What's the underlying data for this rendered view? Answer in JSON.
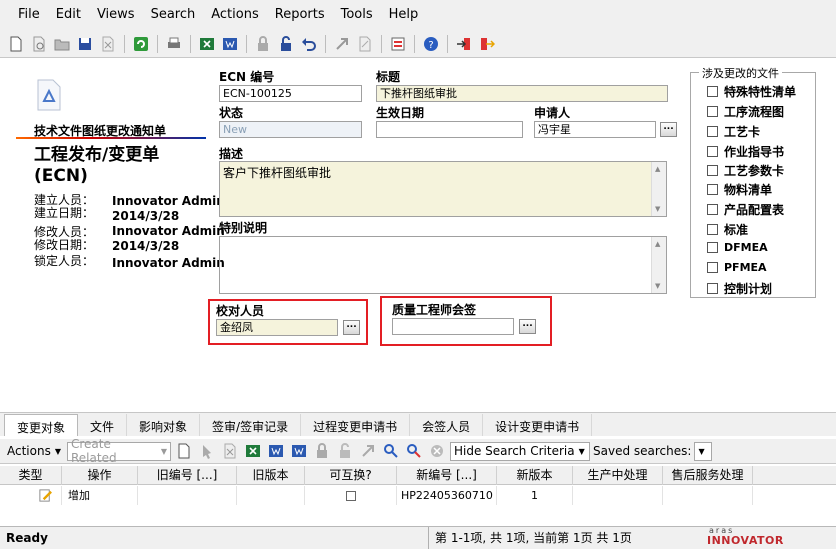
{
  "menu": [
    "File",
    "Edit",
    "Views",
    "Search",
    "Actions",
    "Reports",
    "Tools",
    "Help"
  ],
  "form": {
    "title_small": "技术文件图纸更改通知单",
    "title_big_line1": "工程发布/变更单",
    "title_big_line2": "(ECN)",
    "info": [
      {
        "label": "建立人员：",
        "value": "Innovator Admin"
      },
      {
        "label": "建立日期：",
        "value": "2014/3/28"
      },
      {
        "label": "修改人员：",
        "value": "Innovator Admin"
      },
      {
        "label": "修改日期：",
        "value": "2014/3/28"
      },
      {
        "label": "锁定人员：",
        "value": "Innovator Admin"
      }
    ],
    "ecn_no_label": "ECN 编号",
    "ecn_no_value": "ECN-100125",
    "title_label": "标题",
    "title_value": "下推杆图纸审批",
    "state_label": "状态",
    "state_value": "New",
    "effective_label": "生效日期",
    "effective_value": "",
    "applicant_label": "申请人",
    "applicant_value": "冯宇星",
    "desc_label": "描述",
    "desc_value": "客户下推杆图纸审批",
    "special_label": "特别说明",
    "special_value": "",
    "checker_label": "校对人员",
    "checker_value": "金绍凤",
    "qe_label": "质量工程师会签",
    "qe_value": "",
    "dots": "..."
  },
  "files_group": {
    "legend": "涉及更改的文件",
    "items": [
      "特殊特性清单",
      "工序流程图",
      "工艺卡",
      "作业指导书",
      "工艺参数卡",
      "物料清单",
      "产品配置表",
      "标准",
      "DFMEA",
      "PFMEA",
      "控制计划"
    ]
  },
  "tabs": [
    "变更对象",
    "文件",
    "影响对象",
    "签审/签审记录",
    "过程变更申请书",
    "会签人员",
    "设计变更申请书"
  ],
  "rel_toolbar": {
    "actions": "Actions",
    "create_related": "Create Related",
    "hide_criteria": "Hide Search Criteria",
    "saved_searches": "Saved searches:"
  },
  "grid": {
    "columns": [
      "类型",
      "操作",
      "旧编号 [...]",
      "旧版本",
      "可互换?",
      "新编号 [...]",
      "新版本",
      "生产中处理",
      "售后服务处理"
    ],
    "rows": [
      {
        "action": "增加",
        "old_no": "",
        "old_rev": "",
        "new_no": "HP22405360710",
        "new_rev": "1"
      }
    ]
  },
  "status": {
    "ready": "Ready",
    "pager": "第 1-1项, 共 1项, 当前第 1页 共 1页",
    "logo_top": "aras",
    "logo_bottom": "INNOVATOR"
  },
  "colors": {
    "highlight_border": "#e31e24",
    "yellow_field": "#f5f3dc"
  }
}
